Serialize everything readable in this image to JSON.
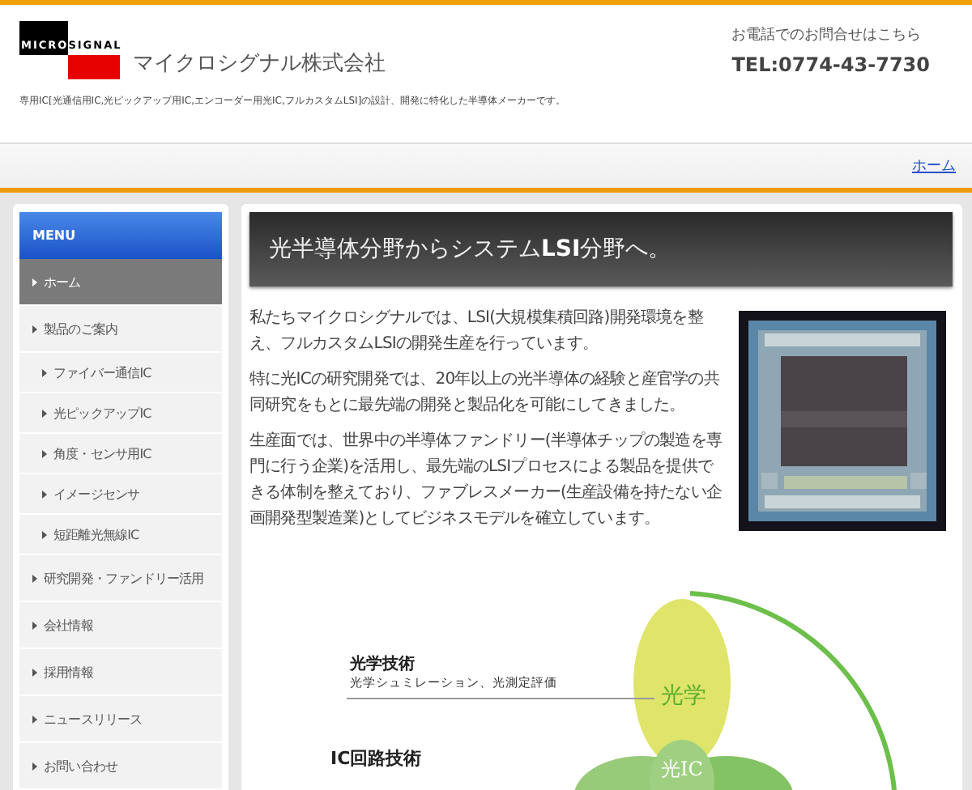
{
  "header": {
    "logo": {
      "top": "MICRO",
      "bottom": "SIGNAL"
    },
    "company": "マイクロシグナル株式会社",
    "tagline": "専用IC[光通信用IC,光ピックアップ用IC,エンコーダー用光IC,フルカスタムLSI]の設計、開発に特化した半導体メーカーです。",
    "contact_label": "お電話でのお問合せはこちら",
    "phone": "TEL:0774-43-7730"
  },
  "breadcrumb": [
    "ホーム"
  ],
  "sidebar": {
    "title": "MENU",
    "items": [
      {
        "label": "ホーム",
        "selected": true
      },
      {
        "label": "製品のご案内",
        "selected": false,
        "children": [
          {
            "label": "ファイバー通信IC",
            "selected": false
          },
          {
            "label": "光ピックアップIC",
            "selected": false
          },
          {
            "label": "角度・センサ用IC",
            "selected": false
          },
          {
            "label": "イメージセンサ",
            "selected": false
          },
          {
            "label": "短距離光無線IC",
            "selected": false
          }
        ]
      },
      {
        "label": "研究開発・ファンドリー活用",
        "selected": false
      },
      {
        "label": "会社情報",
        "selected": false
      },
      {
        "label": "採用情報",
        "selected": false
      },
      {
        "label": "ニュースリリース",
        "selected": false
      },
      {
        "label": "お問い合わせ",
        "selected": false
      }
    ]
  },
  "main": {
    "heading": "光半導体分野からシステム**LSI**分野へ。",
    "paragraphs": [
      "私たちマイクロシグナルでは、LSI(大規模集積回路)開発環境を整え、フルカスタムLSIの開発生産を行っています。",
      "特に光ICの研究開発では、20年以上の光半導体の経験と産官学の共同研究をもとに最先端の開発と製品化を可能にしてきました。",
      "生産面では、世界中の半導体ファンドリー(半導体チップの製造を専門に行う企業)を活用し、最先端のLSIプロセスによる製品を提供できる体制を整えており、ファブレスメーカー(生産設備を持たない企画開発型製造業)としてビジネスモデルを確立しています。"
    ],
    "diagram": {
      "optics_title": "光学技術",
      "optics_desc": "光学シュミレーション、光測定評価",
      "optics_bubble": "光学",
      "ic_title": "IC回路技術",
      "center_bubble": "光IC"
    }
  }
}
